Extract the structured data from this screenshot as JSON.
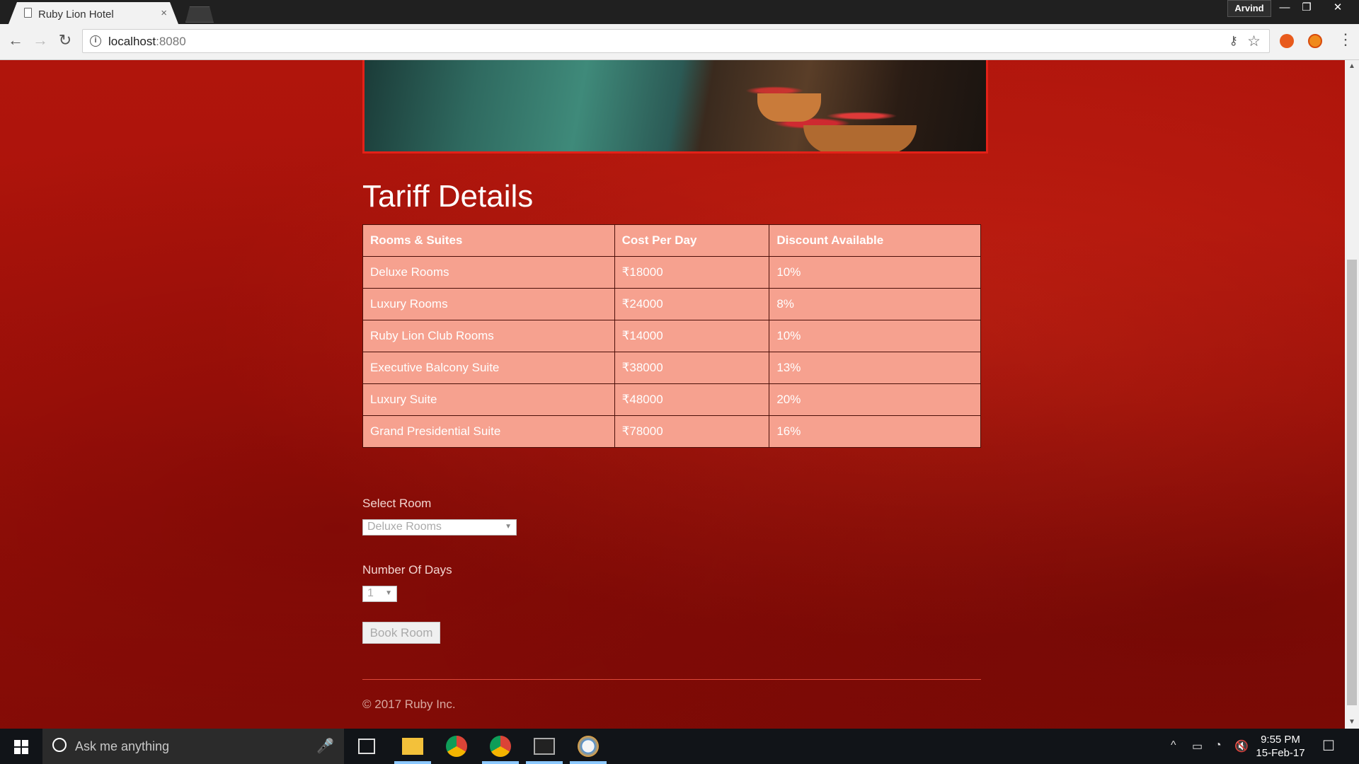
{
  "browser": {
    "tab_title": "Ruby Lion Hotel",
    "tab_close": "×",
    "profile_name": "Arvind",
    "window_controls": {
      "minimize": "—",
      "restore": "❐",
      "close": "✕"
    },
    "nav": {
      "back": "←",
      "forward": "→",
      "reload": "↻"
    },
    "url_host": "localhost",
    "url_port": ":8080",
    "info_icon": "i",
    "key_icon": "⚷",
    "star_icon": "☆",
    "menu_icon": "⋮"
  },
  "page": {
    "title": "Tariff Details",
    "table": {
      "headers": [
        "Rooms & Suites",
        "Cost Per Day",
        "Discount Available"
      ],
      "rows": [
        [
          "Deluxe Rooms",
          "₹18000",
          "10%"
        ],
        [
          "Luxury Rooms",
          "₹24000",
          "8%"
        ],
        [
          "Ruby Lion Club Rooms",
          "₹14000",
          "10%"
        ],
        [
          "Executive Balcony Suite",
          "₹38000",
          "13%"
        ],
        [
          "Luxury Suite",
          "₹48000",
          "20%"
        ],
        [
          "Grand Presidential Suite",
          "₹78000",
          "16%"
        ]
      ]
    },
    "form": {
      "select_room_label": "Select Room",
      "select_room_value": "Deluxe Rooms",
      "days_label": "Number Of Days",
      "days_value": "1",
      "book_button": "Book Room",
      "caret": "▼"
    },
    "footer": "© 2017 Ruby Inc."
  },
  "taskbar": {
    "search_placeholder": "Ask me anything",
    "mic_icon": "🎤",
    "time": "9:55 PM",
    "date": "15-Feb-17",
    "tray": {
      "chevron": "^",
      "battery": "▭",
      "wifi": "◔",
      "volume": "🔇",
      "notifications": "☐"
    }
  },
  "colors": {
    "page_background": "#a8120a",
    "table_background": "#f6a18f",
    "hero_border": "#e32118",
    "taskbar_accent": "#8cc8ff"
  }
}
